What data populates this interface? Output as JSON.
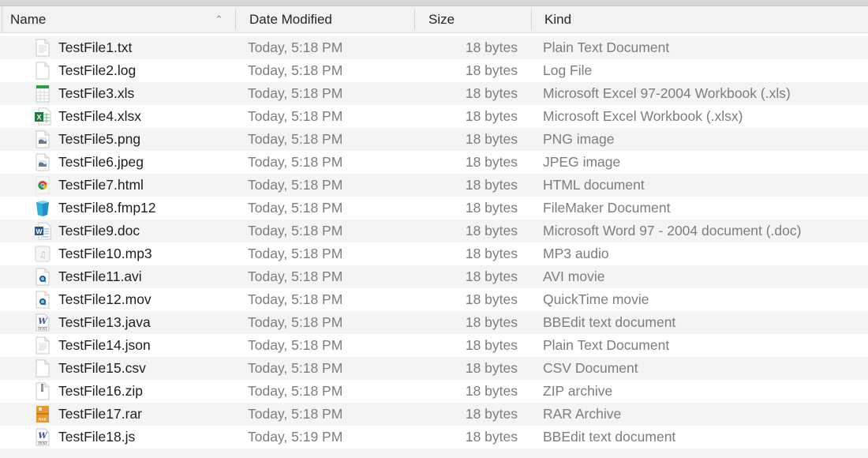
{
  "columns": {
    "name": "Name",
    "date": "Date Modified",
    "size": "Size",
    "kind": "Kind"
  },
  "sort": {
    "column": "name",
    "direction": "ascending",
    "icon": "chevron-up-icon"
  },
  "files": [
    {
      "name": "TestFile1.txt",
      "date": "Today, 5:18 PM",
      "size": "18 bytes",
      "kind": "Plain Text Document",
      "icon": "text-document-icon"
    },
    {
      "name": "TestFile2.log",
      "date": "Today, 5:18 PM",
      "size": "18 bytes",
      "kind": "Log File",
      "icon": "blank-document-icon"
    },
    {
      "name": "TestFile3.xls",
      "date": "Today, 5:18 PM",
      "size": "18 bytes",
      "kind": "Microsoft Excel 97-2004 Workbook (.xls)",
      "icon": "spreadsheet-icon"
    },
    {
      "name": "TestFile4.xlsx",
      "date": "Today, 5:18 PM",
      "size": "18 bytes",
      "kind": "Microsoft Excel Workbook (.xlsx)",
      "icon": "excel-icon"
    },
    {
      "name": "TestFile5.png",
      "date": "Today, 5:18 PM",
      "size": "18 bytes",
      "kind": "PNG image",
      "icon": "image-icon"
    },
    {
      "name": "TestFile6.jpeg",
      "date": "Today, 5:18 PM",
      "size": "18 bytes",
      "kind": "JPEG image",
      "icon": "image-icon"
    },
    {
      "name": "TestFile7.html",
      "date": "Today, 5:18 PM",
      "size": "18 bytes",
      "kind": "HTML document",
      "icon": "chrome-icon"
    },
    {
      "name": "TestFile8.fmp12",
      "date": "Today, 5:18 PM",
      "size": "18 bytes",
      "kind": "FileMaker Document",
      "icon": "filemaker-icon"
    },
    {
      "name": "TestFile9.doc",
      "date": "Today, 5:18 PM",
      "size": "18 bytes",
      "kind": "Microsoft Word 97 - 2004 document (.doc)",
      "icon": "word-icon"
    },
    {
      "name": "TestFile10.mp3",
      "date": "Today, 5:18 PM",
      "size": "18 bytes",
      "kind": "MP3 audio",
      "icon": "music-note-icon"
    },
    {
      "name": "TestFile11.avi",
      "date": "Today, 5:18 PM",
      "size": "18 bytes",
      "kind": "AVI movie",
      "icon": "quicktime-icon"
    },
    {
      "name": "TestFile12.mov",
      "date": "Today, 5:18 PM",
      "size": "18 bytes",
      "kind": "QuickTime movie",
      "icon": "quicktime-icon"
    },
    {
      "name": "TestFile13.java",
      "date": "Today, 5:18 PM",
      "size": "18 bytes",
      "kind": "BBEdit text document",
      "icon": "bbedit-icon"
    },
    {
      "name": "TestFile14.json",
      "date": "Today, 5:18 PM",
      "size": "18 bytes",
      "kind": "Plain Text Document",
      "icon": "text-document-icon"
    },
    {
      "name": "TestFile15.csv",
      "date": "Today, 5:18 PM",
      "size": "18 bytes",
      "kind": "CSV Document",
      "icon": "blank-document-icon"
    },
    {
      "name": "TestFile16.zip",
      "date": "Today, 5:18 PM",
      "size": "18 bytes",
      "kind": "ZIP archive",
      "icon": "zip-icon"
    },
    {
      "name": "TestFile17.rar",
      "date": "Today, 5:18 PM",
      "size": "18 bytes",
      "kind": "RAR Archive",
      "icon": "rar-icon"
    },
    {
      "name": "TestFile18.js",
      "date": "Today, 5:19 PM",
      "size": "18 bytes",
      "kind": "BBEdit text document",
      "icon": "bbedit-icon"
    }
  ],
  "colors": {
    "header_bg": "#f2f2f2",
    "row_alt_bg": "#f4f4f4",
    "name_text": "#1f1f1f",
    "secondary_text": "#7d7d7d"
  }
}
